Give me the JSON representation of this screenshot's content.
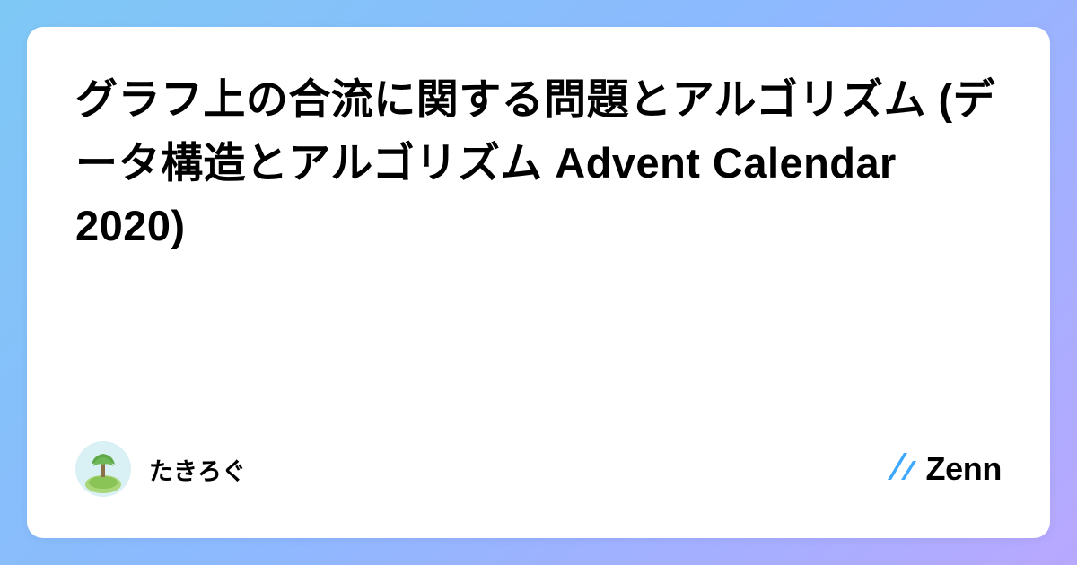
{
  "card": {
    "title": "グラフ上の合流に関する問題とアルゴリズム (データ構造とアルゴリズム Advent Calendar 2020)"
  },
  "author": {
    "name": "たきろぐ"
  },
  "brand": {
    "name": "Zenn"
  }
}
